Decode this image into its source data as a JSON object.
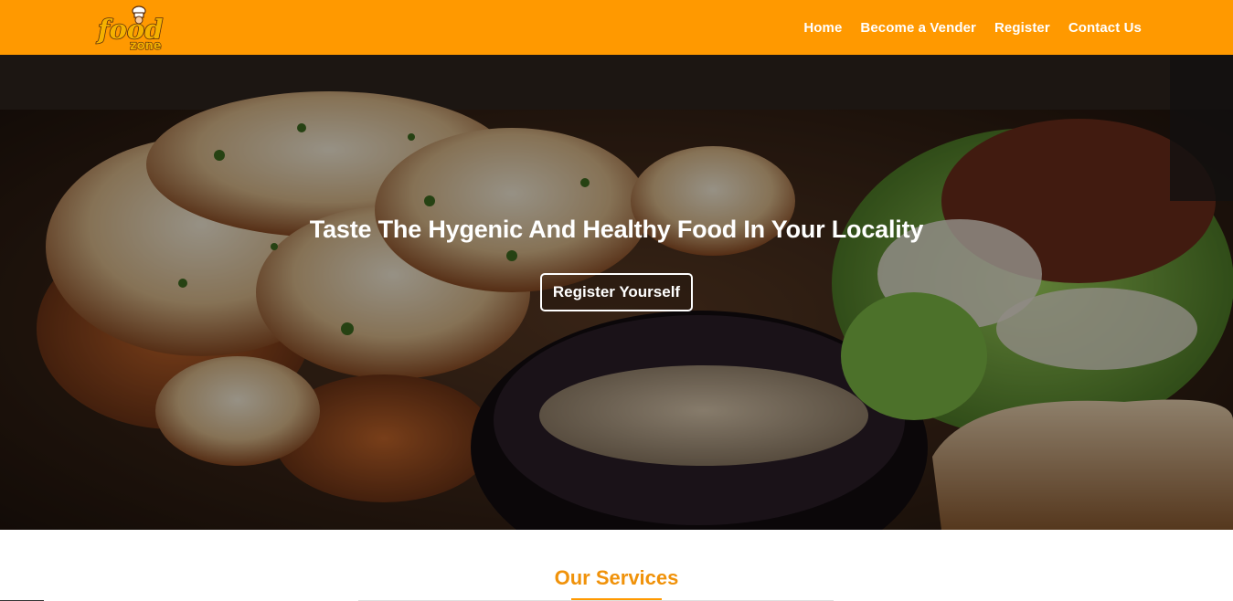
{
  "brand": {
    "logo_word_1": "food",
    "logo_word_2": "zone",
    "logo_icon": "chef-hat-icon",
    "color_primary": "#ff9900",
    "color_accent_text": "#f0920a"
  },
  "nav": {
    "items": [
      {
        "label": "Home"
      },
      {
        "label": "Become a Vender"
      },
      {
        "label": "Register"
      },
      {
        "label": "Contact Us"
      }
    ]
  },
  "hero": {
    "title": "Taste The Hygenic And Healthy Food In Your Locality",
    "button_label": "Register Yourself"
  },
  "services": {
    "title": "Our Services"
  }
}
